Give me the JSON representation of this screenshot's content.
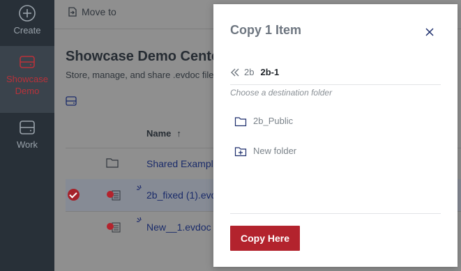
{
  "rail": {
    "create_label": "Create",
    "showcase_label_line1": "Showcase",
    "showcase_label_line2": "Demo",
    "work_label": "Work"
  },
  "toolbar": {
    "move_to_label": "Move to"
  },
  "page": {
    "title": "Showcase Demo Center",
    "subtitle": "Store, manage, and share .evdoc files"
  },
  "table": {
    "name_header": "Name",
    "sort_indicator": "↑",
    "rows": [
      {
        "name": "Shared Examples",
        "type": "folder",
        "selected": false
      },
      {
        "name": "2b_fixed (1).evdoc",
        "type": "evdoc",
        "selected": true
      },
      {
        "name": "New__1.evdoc",
        "type": "evdoc",
        "selected": false
      }
    ]
  },
  "modal": {
    "title": "Copy 1 Item",
    "breadcrumb_parent": "2b",
    "breadcrumb_current": "2b-1",
    "hint": "Choose a destination folder",
    "folders": [
      {
        "label": "2b_Public",
        "icon": "folder-icon"
      },
      {
        "label": "New folder",
        "icon": "new-folder-icon"
      }
    ],
    "copy_button_label": "Copy Here"
  },
  "colors": {
    "accent": "#b3232d",
    "rail_bg": "#283038",
    "overlay_bg": "#8f8f8f",
    "link": "#1a2b6a"
  }
}
